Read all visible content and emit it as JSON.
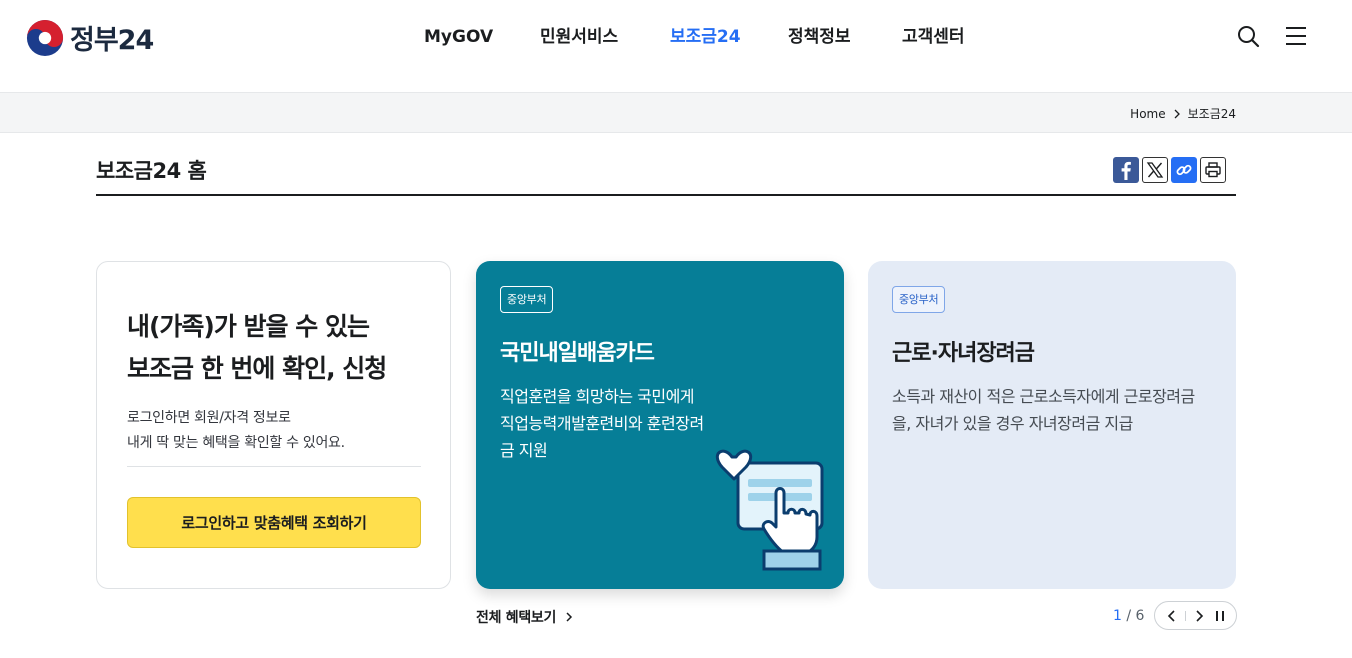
{
  "header": {
    "logo_text": "정부24",
    "nav": [
      {
        "label": "MyGOV"
      },
      {
        "label": "민원서비스"
      },
      {
        "label": "보조금24"
      },
      {
        "label": "정책정보"
      },
      {
        "label": "고객센터"
      }
    ],
    "active_nav": "보조금24"
  },
  "breadcrumb": {
    "home": "Home",
    "current": "보조금24"
  },
  "page": {
    "title": "보조금24 홈"
  },
  "login_card": {
    "headline_line1": "내(가족)가 받을 수 있는",
    "headline_line2": "보조금 한 번에 확인, 신청",
    "desc_line1": "로그인하면 회원/자격 정보로",
    "desc_line2": "내게 딱 맞는 혜택을 확인할 수 있어요.",
    "button_label": "로그인하고 맞춤혜택 조회하기"
  },
  "cards": [
    {
      "badge": "중앙부처",
      "title": "국민내일배움카드",
      "description": "직업훈련을 희망하는 국민에게 직업능력개발훈련비와 훈련장려금 지원"
    },
    {
      "badge": "중앙부처",
      "title": "근로·자녀장려금",
      "description": "소득과 재산이 적은 근로소득자에게 근로장려금을, 자녀가 있을 경우 자녀장려금 지급"
    }
  ],
  "footer": {
    "all_link": "전체 혜택보기",
    "pager_current": "1",
    "pager_sep": " / ",
    "pager_total": "6"
  },
  "colors": {
    "accent": "#256ef4",
    "card_main_bg": "#067e97",
    "card_side_bg": "#e4ebf6",
    "login_button": "#ffdf4d"
  },
  "icons": {
    "search": "search-icon",
    "menu": "menu-icon",
    "facebook": "facebook-icon",
    "x": "x-icon",
    "link": "link-icon",
    "print": "print-icon",
    "prev": "chevron-left-icon",
    "next": "chevron-right-icon",
    "pause": "pause-icon"
  }
}
